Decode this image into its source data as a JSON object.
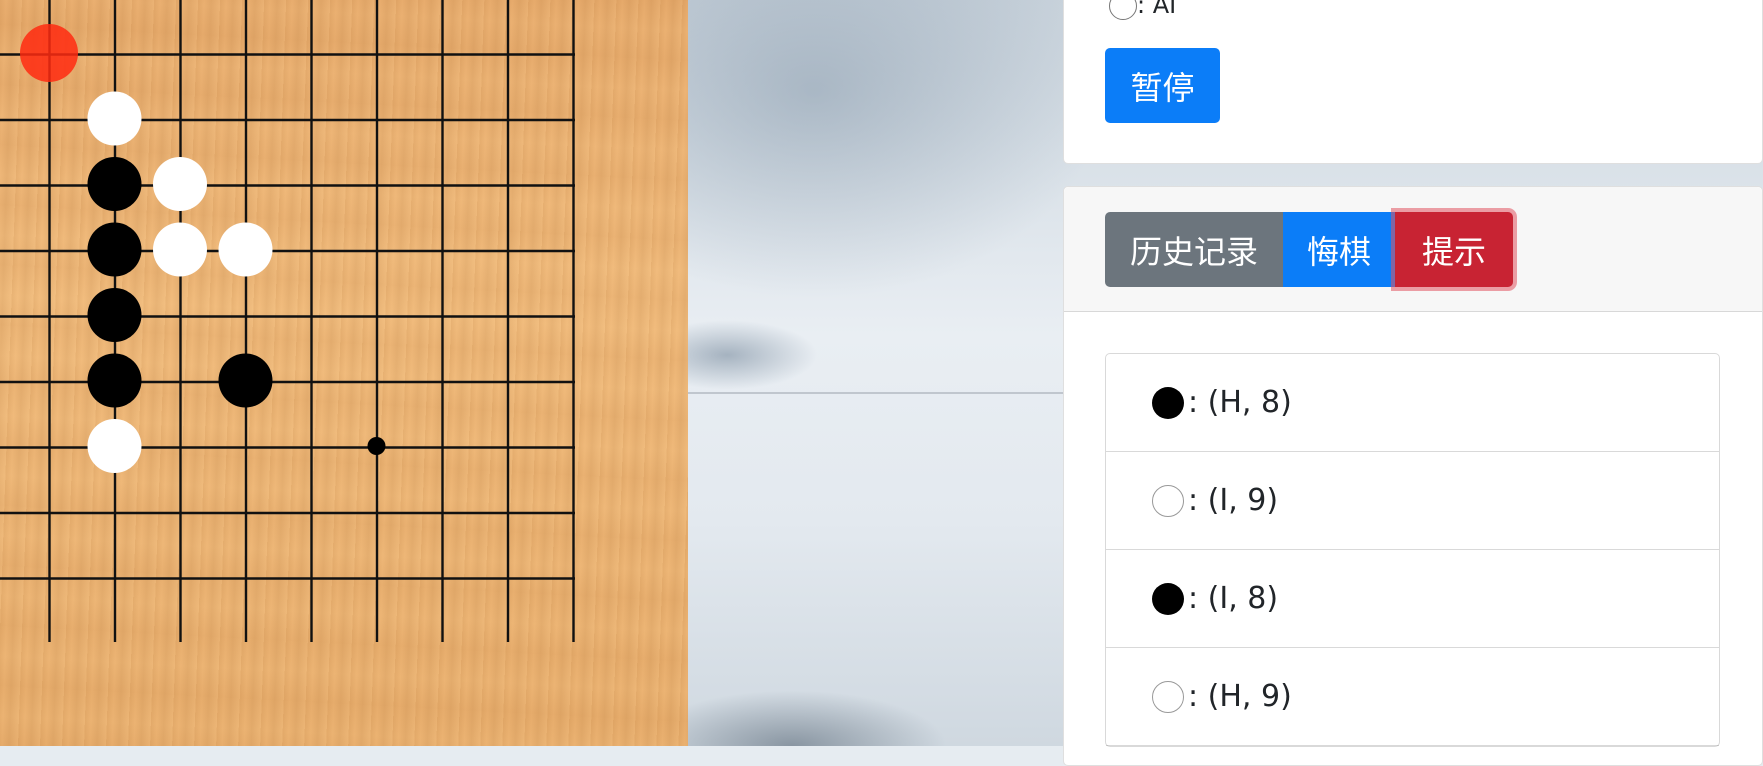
{
  "board": {
    "stones": [
      {
        "color": "white",
        "col": 2,
        "row": 1
      },
      {
        "color": "black",
        "col": 2,
        "row": 2
      },
      {
        "color": "white",
        "col": 3,
        "row": 2
      },
      {
        "color": "black",
        "col": 2,
        "row": 3
      },
      {
        "color": "white",
        "col": 3,
        "row": 3
      },
      {
        "color": "white",
        "col": 4,
        "row": 3
      },
      {
        "color": "black",
        "col": 2,
        "row": 4
      },
      {
        "color": "black",
        "col": 2,
        "row": 5
      },
      {
        "color": "black",
        "col": 4,
        "row": 5
      },
      {
        "color": "white",
        "col": 2,
        "row": 6
      }
    ],
    "last_move_marker": {
      "col": 1,
      "row": 0,
      "color": "#ff2a10"
    },
    "star_points": [
      {
        "col": 6,
        "row": 6
      }
    ]
  },
  "control": {
    "radio_label": ": AI",
    "pause_label": "暂停"
  },
  "history": {
    "history_label": "历史记录",
    "undo_label": "悔棋",
    "hint_label": "提示",
    "moves": [
      {
        "stone": "black",
        "text": ": (H, 8)"
      },
      {
        "stone": "white",
        "text": ": (I, 9)"
      },
      {
        "stone": "black",
        "text": ": (I, 8)"
      },
      {
        "stone": "white",
        "text": ": (H, 9)"
      }
    ]
  },
  "colors": {
    "primary": "#0b7df8",
    "secondary": "#6c757d",
    "danger": "#c82333"
  }
}
